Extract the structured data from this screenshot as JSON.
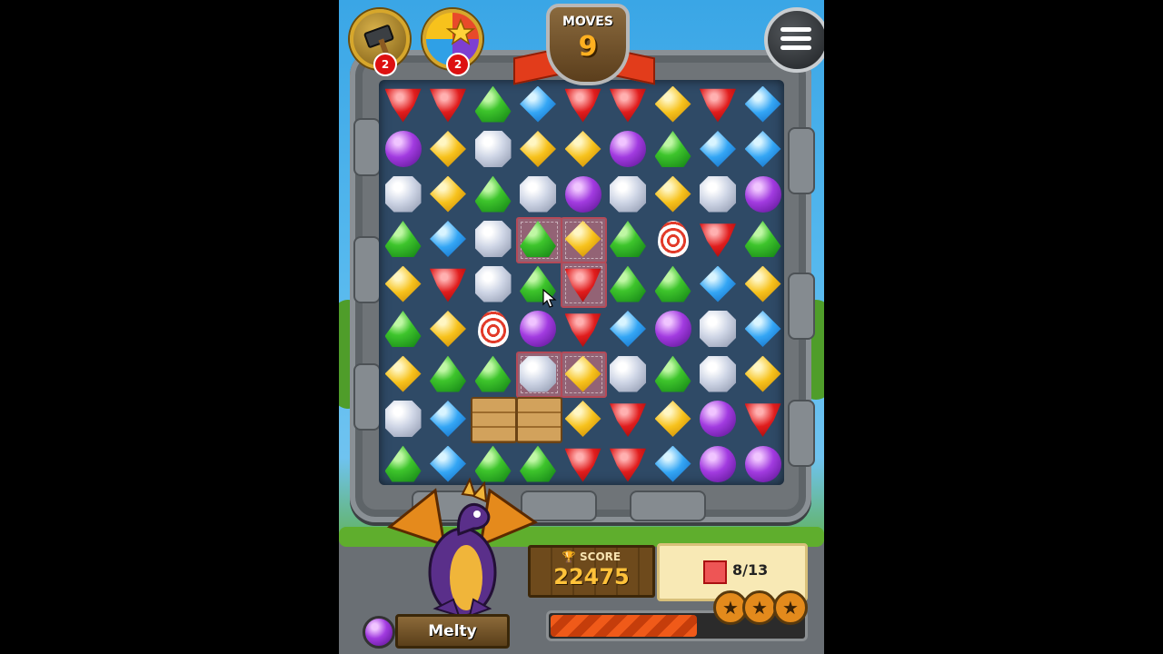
{
  "hud": {
    "moves_label": "MOVES",
    "moves_value": "9",
    "boosters": [
      {
        "name": "hammer-booster",
        "count": "2"
      },
      {
        "name": "star-booster",
        "count": "2"
      }
    ],
    "menu_icon": "menu-icon"
  },
  "board": {
    "rows": [
      [
        "red",
        "red",
        "green",
        "blue",
        "red",
        "red",
        "yellow",
        "red",
        "blue"
      ],
      [
        "purple",
        "yellow",
        "white",
        "yellow",
        "yellow",
        "purple",
        "green",
        "blue",
        "blue"
      ],
      [
        "white",
        "yellow",
        "green",
        "white",
        "purple",
        "white",
        "yellow",
        "white",
        "purple"
      ],
      [
        "green",
        "blue",
        "white",
        "green",
        "yellow",
        "green",
        "egg",
        "red",
        "green"
      ],
      [
        "yellow",
        "red",
        "white",
        "green",
        "red",
        "green",
        "green",
        "blue",
        "yellow"
      ],
      [
        "green",
        "yellow",
        "egg",
        "purple",
        "red",
        "blue",
        "purple",
        "white",
        "blue"
      ],
      [
        "yellow",
        "green",
        "green",
        "white",
        "yellow",
        "white",
        "green",
        "white",
        "yellow"
      ],
      [
        "white",
        "blue",
        "crate",
        "crate",
        "yellow",
        "red",
        "yellow",
        "purple",
        "red"
      ],
      [
        "green",
        "blue",
        "green",
        "green",
        "red",
        "red",
        "blue",
        "purple",
        "purple"
      ]
    ],
    "tile_cells": [
      [
        3,
        3
      ],
      [
        3,
        4
      ],
      [
        4,
        4
      ],
      [
        6,
        3
      ],
      [
        6,
        4
      ]
    ]
  },
  "score": {
    "label": "SCORE",
    "value": "22475"
  },
  "goal": {
    "text": "8/13",
    "icon": "pink-tile-icon"
  },
  "character": {
    "name": "Melty"
  },
  "progress": {
    "fill_fraction": 0.57
  },
  "stars": [
    "star-icon",
    "star-icon",
    "star-icon"
  ],
  "colors": {
    "accent": "#f05a19",
    "board": "#2f4a66",
    "frame": "#6f7478"
  }
}
